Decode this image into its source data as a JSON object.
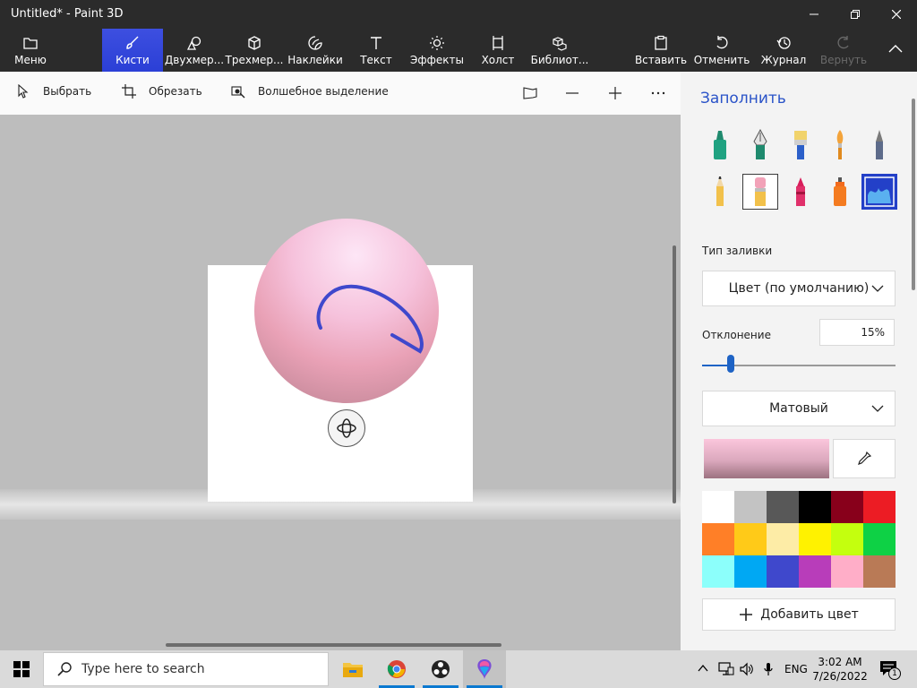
{
  "window": {
    "title": "Untitled* - Paint 3D"
  },
  "toolbar": {
    "menu": "Меню",
    "brushes": "Кисти",
    "shapes2d": "Двухмер...",
    "shapes3d": "Трехмер...",
    "stickers": "Наклейки",
    "text": "Текст",
    "effects": "Эффекты",
    "canvas": "Холст",
    "library": "Библиот...",
    "paste": "Вставить",
    "undo": "Отменить",
    "history": "Журнал",
    "redo": "Вернуть"
  },
  "subbar": {
    "select": "Выбрать",
    "crop": "Обрезать",
    "magic_select": "Волшебное выделение"
  },
  "panel": {
    "title": "Заполнить",
    "fill_type_label": "Тип заливки",
    "fill_type_value": "Цвет (по умолчанию)",
    "deviation_label": "Отклонение",
    "deviation_value": "15%",
    "deviation_level": 0.15,
    "finish_value": "Матовый",
    "add_color": "Добавить цвет",
    "palette": [
      "#ffffff",
      "#c3c3c3",
      "#585858",
      "#000000",
      "#88001b",
      "#ec1c24",
      "#ff7f27",
      "#ffca18",
      "#fdeca6",
      "#fff200",
      "#c4ff0e",
      "#0ed145",
      "#8cfffb",
      "#00a8f3",
      "#3f48cc",
      "#b83dba",
      "#ffaec8",
      "#b97a56"
    ]
  },
  "taskbar": {
    "search_placeholder": "Type here to search",
    "lang": "ENG",
    "time": "3:02 AM",
    "date": "7/26/2022",
    "notifications": "1"
  },
  "colors": {
    "accent": "#2b3fd6",
    "link": "#2a53c8",
    "slider": "#1e63c5",
    "stroke": "#3f48cc"
  }
}
